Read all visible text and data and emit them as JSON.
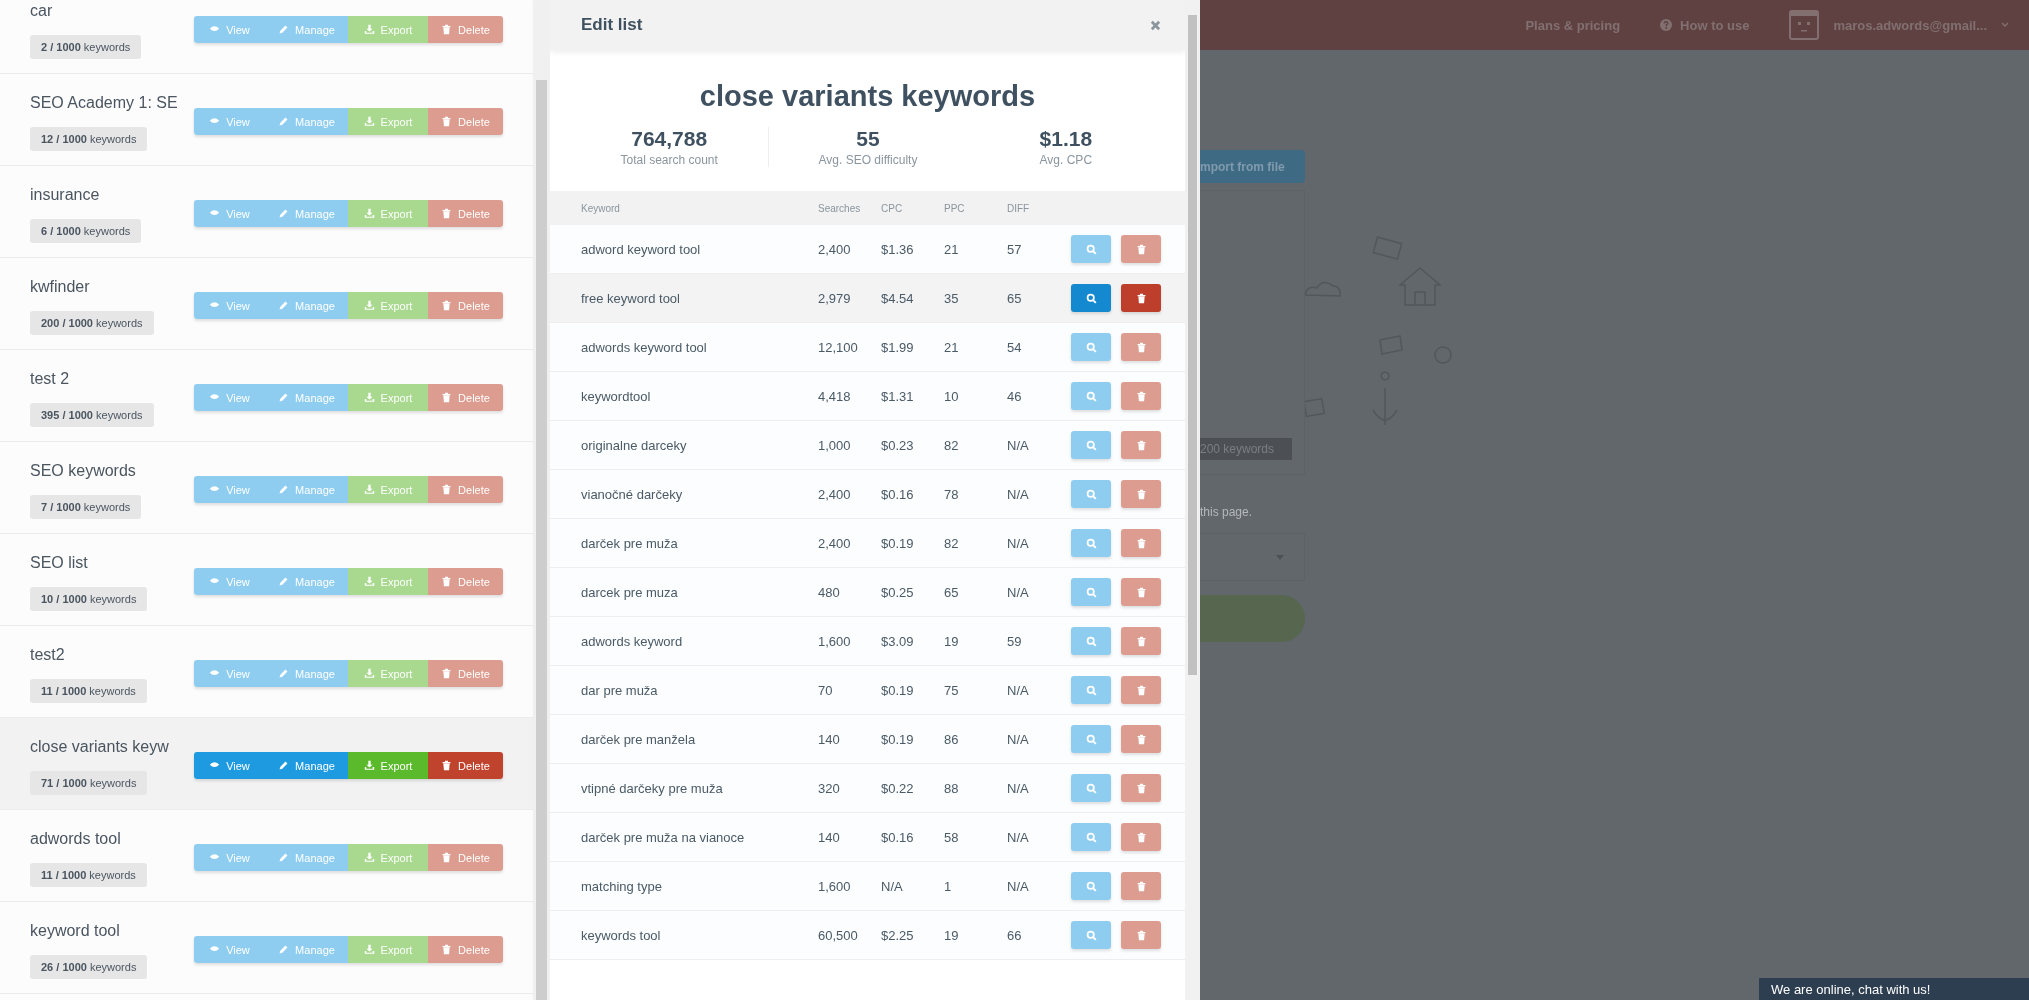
{
  "sidebar": {
    "lists": [
      {
        "name": "car",
        "badge": "**2 / 1000** keywords",
        "selected": false,
        "actions": [
          "View",
          "Manage",
          "Export",
          "Delete"
        ]
      },
      {
        "name": "SEO Academy 1: SE",
        "badge": "**12 / 1000** keywords",
        "selected": false,
        "actions": [
          "View",
          "Manage",
          "Export",
          "Delete"
        ]
      },
      {
        "name": "insurance",
        "badge": "**6 / 1000** keywords",
        "selected": false,
        "actions": [
          "View",
          "Manage",
          "Export",
          "Delete"
        ]
      },
      {
        "name": "kwfinder",
        "badge": "**200 / 1000** keywords",
        "selected": false,
        "actions": [
          "View",
          "Manage",
          "Export",
          "Delete"
        ]
      },
      {
        "name": "test 2",
        "badge": "**395 / 1000** keywords",
        "selected": false,
        "actions": [
          "View",
          "Manage",
          "Export",
          "Delete"
        ]
      },
      {
        "name": "SEO keywords",
        "badge": "**7 / 1000** keywords",
        "selected": false,
        "actions": [
          "View",
          "Manage",
          "Export",
          "Delete"
        ]
      },
      {
        "name": "SEO list",
        "badge": "**10 / 1000** keywords",
        "selected": false,
        "actions": [
          "View",
          "Manage",
          "Export",
          "Delete"
        ]
      },
      {
        "name": "test2",
        "badge": "**11 / 1000** keywords",
        "selected": false,
        "actions": [
          "View",
          "Manage",
          "Export",
          "Delete"
        ]
      },
      {
        "name": "close variants keyw",
        "badge": "**71 / 1000** keywords",
        "selected": true,
        "actions": [
          "View",
          "Manage",
          "Export",
          "Delete"
        ]
      },
      {
        "name": "adwords tool",
        "badge": "**11 / 1000** keywords",
        "selected": false,
        "actions": [
          "View",
          "Manage",
          "Export",
          "Delete"
        ]
      },
      {
        "name": "keyword tool",
        "badge": "**26 / 1000** keywords",
        "selected": false,
        "actions": [
          "View",
          "Manage",
          "Export",
          "Delete"
        ]
      }
    ]
  },
  "modal": {
    "title": "Edit list",
    "heading": "close variants keywords",
    "stats": [
      {
        "value": "764,788",
        "label": "Total search count"
      },
      {
        "value": "55",
        "label": "Avg. SEO difficulty"
      },
      {
        "value": "$1.18",
        "label": "Avg. CPC"
      }
    ],
    "table": {
      "columns": [
        "Keyword",
        "Searches",
        "CPC",
        "PPC",
        "DIFF"
      ],
      "rows": [
        {
          "cells": [
            "adword keyword tool",
            "2,400",
            "$1.36",
            "21",
            "57"
          ],
          "selected": false
        },
        {
          "cells": [
            "free keyword tool",
            "2,979",
            "$4.54",
            "35",
            "65"
          ],
          "selected": true
        },
        {
          "cells": [
            "adwords keyword tool",
            "12,100",
            "$1.99",
            "21",
            "54"
          ],
          "selected": false
        },
        {
          "cells": [
            "keywordtool",
            "4,418",
            "$1.31",
            "10",
            "46"
          ],
          "selected": false
        },
        {
          "cells": [
            "originalne darceky",
            "1,000",
            "$0.23",
            "82",
            "N/A"
          ],
          "selected": false
        },
        {
          "cells": [
            "vianočné darčeky",
            "2,400",
            "$0.16",
            "78",
            "N/A"
          ],
          "selected": false
        },
        {
          "cells": [
            "darček pre muža",
            "2,400",
            "$0.19",
            "82",
            "N/A"
          ],
          "selected": false
        },
        {
          "cells": [
            "darcek pre muza",
            "480",
            "$0.25",
            "65",
            "N/A"
          ],
          "selected": false
        },
        {
          "cells": [
            "adwords keyword",
            "1,600",
            "$3.09",
            "19",
            "59"
          ],
          "selected": false
        },
        {
          "cells": [
            "dar pre muža",
            "70",
            "$0.19",
            "75",
            "N/A"
          ],
          "selected": false
        },
        {
          "cells": [
            "darček pre manžela",
            "140",
            "$0.19",
            "86",
            "N/A"
          ],
          "selected": false
        },
        {
          "cells": [
            "vtipné darčeky pre muža",
            "320",
            "$0.22",
            "88",
            "N/A"
          ],
          "selected": false
        },
        {
          "cells": [
            "darček pre muža na vianoce",
            "140",
            "$0.16",
            "58",
            "N/A"
          ],
          "selected": false
        },
        {
          "cells": [
            "matching type",
            "1,600",
            "N/A",
            "1",
            "N/A"
          ],
          "selected": false
        },
        {
          "cells": [
            "keywords tool",
            "60,500",
            "$2.25",
            "19",
            "66"
          ],
          "selected": false
        }
      ]
    }
  },
  "background_page": {
    "nav": {
      "links": [
        "Plans & pricing",
        "How to use"
      ],
      "account": "maros.adwords@gmail..."
    },
    "import_button": "mport from file",
    "keyword_badge": "200 keywords",
    "note": "this page.",
    "chat": "We are online, chat with us!"
  }
}
